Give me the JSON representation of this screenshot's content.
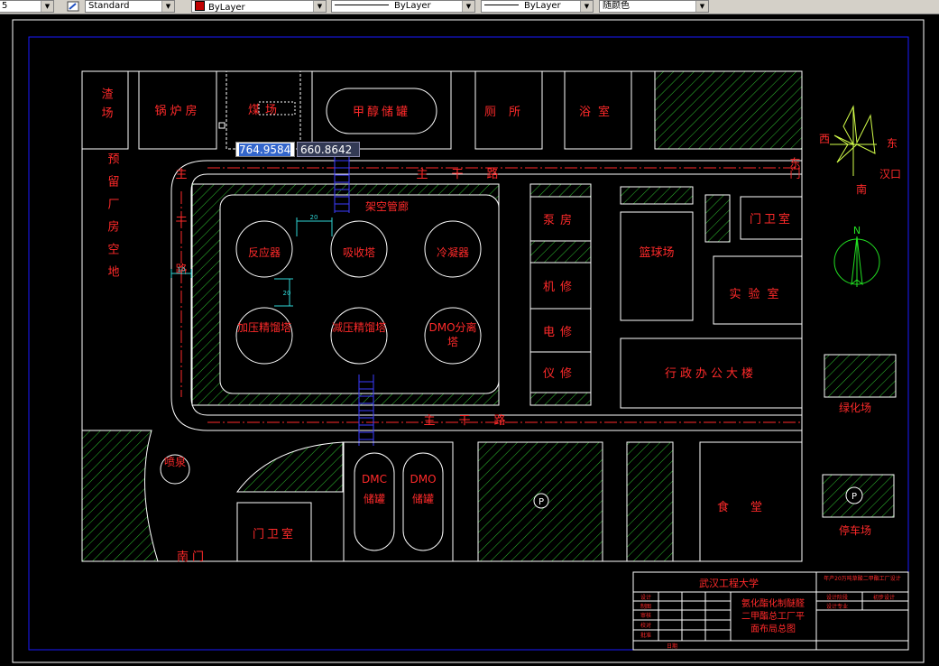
{
  "toolbar": {
    "scale_value": "5",
    "text_style": "Standard",
    "color_layer": "ByLayer",
    "linetype": "ByLayer",
    "lineweight": "ByLayer",
    "plot_style": "随颜色"
  },
  "dynamic_input": {
    "x_value": "764.9584",
    "y_value": "660.8642"
  },
  "colors": {
    "background": "#000000",
    "outline": "#ffffff",
    "label": "#ff2a2a",
    "hatch": "#2fbf2f",
    "frame": "#1a1aff",
    "ladder": "#3b3bff",
    "dim": "#2fd6d6",
    "compass": "#d4ff4a"
  },
  "drawing": {
    "buildings": {
      "slag_yard": "渣场",
      "boiler_room": "锅炉房",
      "coal_yard": "煤场",
      "methanol_tank": "甲醇储罐",
      "toilet": "厕所",
      "bathroom": "浴室",
      "reserved_plant": "预留厂房空地",
      "pump_room": "泵房",
      "gate_house_east": "门卫室",
      "basketball": "篮球场",
      "machine_repair": "机修",
      "electric_repair": "电修",
      "instrument_repair": "仪修",
      "laboratory": "实验室",
      "admin_building": "行政办公大楼",
      "fountain": "喷泉",
      "gate_house_south": "门卫室",
      "dmc_tank": "DMC储罐",
      "dmo_tank": "DMO储罐",
      "canteen": "食堂",
      "green_area": "绿化场",
      "parking": "停车场",
      "parking_symbol": "P"
    },
    "equipment": {
      "reactor": "反应器",
      "absorber": "吸收塔",
      "condenser": "冷凝器",
      "pressurized_tower": "加压精馏塔",
      "vacuum_tower": "减压精馏塔",
      "dmo_separator": "DMO分离塔"
    },
    "roads": {
      "main_road_top": "主干路",
      "main_road_bottom": "主干路",
      "main_road_left": "主干路",
      "pipe_rack": "架空管廊",
      "east_gate": "东门",
      "south_gate": "南门"
    },
    "dimensions": {
      "dim_horizontal": "20",
      "dim_vertical": "20",
      "dim_road": "10"
    },
    "compass": {
      "west": "西",
      "east": "东",
      "south": "南",
      "hankou": "汉口",
      "north": "N"
    },
    "title_block": {
      "school": "武汉工程大学",
      "project": "年产20万吨草酸二甲酯工厂设计",
      "drawing_title_1": "氨化酯化制醚醛",
      "drawing_title_2": "二甲酯总工厂平",
      "drawing_title_3": "面布局总图",
      "rows_left": [
        "设计",
        "制图",
        "审核",
        "校对",
        "批准"
      ],
      "rows_right_1": "设计阶段",
      "rows_right_2": "设计专业",
      "rows_right_3": "初步设计",
      "footer": "日期"
    }
  }
}
